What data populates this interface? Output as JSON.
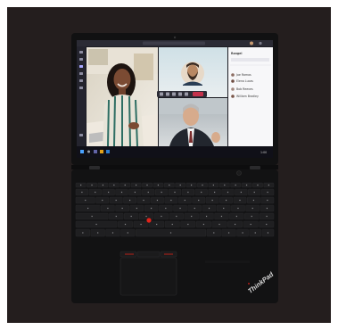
{
  "teams": {
    "panel_title": "Rangel",
    "participants": [
      {
        "name": "Joe Ramos"
      },
      {
        "name": "Elena Lucas"
      },
      {
        "name": "Bob Reeves"
      },
      {
        "name": "William Bradley"
      }
    ]
  },
  "brand": {
    "lid_logo": "ThinkPad",
    "accent_color": "#e2231a"
  },
  "taskbar": {
    "time": "1:00"
  }
}
